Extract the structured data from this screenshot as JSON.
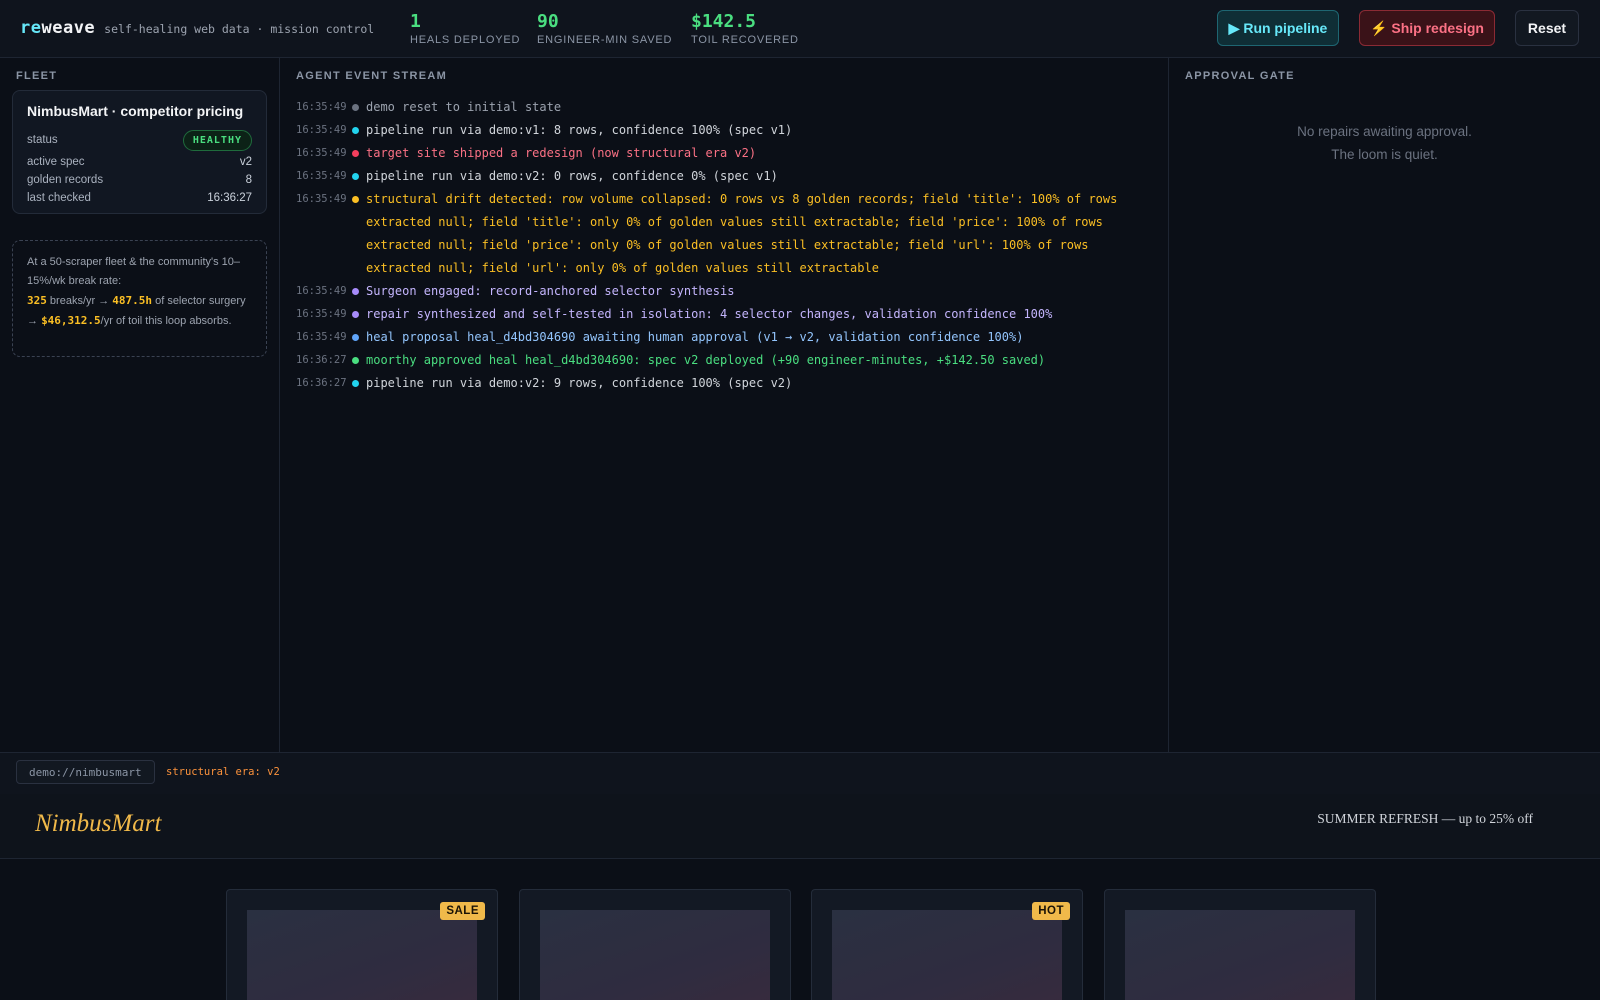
{
  "brand": {
    "logo_accent": "re",
    "logo_rest": "weave",
    "tagline": "self-healing web data · mission control"
  },
  "stats": [
    {
      "value": "1",
      "label": "HEALS DEPLOYED"
    },
    {
      "value": "90",
      "label": "ENGINEER-MIN SAVED"
    },
    {
      "value": "$142.5",
      "label": "TOIL RECOVERED"
    }
  ],
  "buttons": {
    "run": "▶ Run pipeline",
    "ship": "⚡ Ship redesign",
    "reset": "Reset"
  },
  "fleet": {
    "title": "FLEET",
    "card": {
      "name": "NimbusMart · competitor pricing",
      "status_label": "status",
      "status": "HEALTHY",
      "spec_label": "active spec",
      "spec": "v2",
      "golden_label": "golden records",
      "golden": "8",
      "checked_label": "last checked",
      "checked": "16:36:27"
    },
    "note": {
      "line1": "At a 50-scraper fleet & the community's 10–15%/wk break rate:",
      "breaks": "325",
      "breaks_suffix": " breaks/yr → ",
      "hours": "487.5h",
      "hours_suffix": " of selector surgery → ",
      "cost": "$46,312.5",
      "cost_suffix": "/yr of toil this loop absorbs."
    }
  },
  "stream": {
    "title": "AGENT EVENT STREAM",
    "events": [
      {
        "time": "16:35:49",
        "text": "demo reset to initial state",
        "dot": "#6b7280",
        "color": "#9ca3af"
      },
      {
        "time": "16:35:49",
        "text": "pipeline run via demo:v1: 8 rows, confidence 100% (spec v1)",
        "dot": "#22d3ee",
        "color": "#d1d5db"
      },
      {
        "time": "16:35:49",
        "text": "target site shipped a redesign (now structural era v2)",
        "dot": "#f43f5e",
        "color": "#fb7185"
      },
      {
        "time": "16:35:49",
        "text": "pipeline run via demo:v2: 0 rows, confidence 0% (spec v1)",
        "dot": "#22d3ee",
        "color": "#d1d5db"
      },
      {
        "time": "16:35:49",
        "text": "structural drift detected: row volume collapsed: 0 rows vs 8 golden records; field 'title': 100% of rows extracted null; field 'title': only 0% of golden values still extractable; field 'price': 100% of rows extracted null; field 'price': only 0% of golden values still extractable; field 'url': 100% of rows extracted null; field 'url': only 0% of golden values still extractable",
        "dot": "#fbbf24",
        "color": "#fbbf24"
      },
      {
        "time": "16:35:49",
        "text": "Surgeon engaged: record-anchored selector synthesis",
        "dot": "#a78bfa",
        "color": "#c4b5fd"
      },
      {
        "time": "16:35:49",
        "text": "repair synthesized and self-tested in isolation: 4 selector changes, validation confidence 100%",
        "dot": "#a78bfa",
        "color": "#c4b5fd"
      },
      {
        "time": "16:35:49",
        "text": "heal proposal heal_d4bd304690 awaiting human approval (v1 → v2, validation confidence 100%)",
        "dot": "#60a5fa",
        "color": "#93c5fd"
      },
      {
        "time": "16:36:27",
        "text": "moorthy approved heal heal_d4bd304690: spec v2 deployed (+90 engineer-minutes, +$142.50 saved)",
        "dot": "#4ade80",
        "color": "#4ade80"
      },
      {
        "time": "16:36:27",
        "text": "pipeline run via demo:v2: 9 rows, confidence 100% (spec v2)",
        "dot": "#22d3ee",
        "color": "#d1d5db"
      }
    ]
  },
  "approval": {
    "title": "APPROVAL GATE",
    "empty_line1": "No repairs awaiting approval.",
    "empty_line2": "The loom is quiet."
  },
  "preview": {
    "url": "demo://nimbusmart",
    "era": "structural era: v2",
    "site_logo": "NimbusMart",
    "promo": "SUMMER REFRESH — up to 25% off",
    "products": [
      {
        "tag": "SALE"
      },
      {
        "tag": ""
      },
      {
        "tag": "HOT"
      },
      {
        "tag": ""
      }
    ]
  }
}
